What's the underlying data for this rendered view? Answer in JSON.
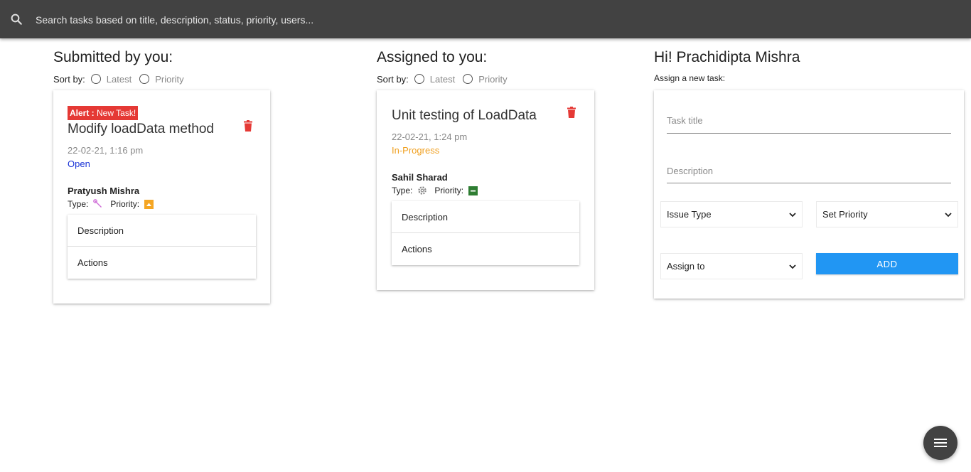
{
  "search": {
    "placeholder": "Search tasks based on title, description, status, priority, users..."
  },
  "submitted": {
    "heading": "Submitted by you:",
    "sort_label": "Sort by:",
    "sort_options": [
      "Latest",
      "Priority"
    ],
    "task": {
      "alert_prefix": "Alert : ",
      "alert_text": "New Task!",
      "title": "Modify loadData method",
      "date": "22-02-21, 1:16 pm",
      "status": "Open",
      "status_color": "#1a33d6",
      "user": "Pratyush Mishra",
      "type_label": "Type:",
      "priority_label": "Priority:",
      "type_icon": "wrench-icon",
      "priority_icon": "priority-high-icon",
      "accordion": [
        "Description",
        "Actions"
      ]
    }
  },
  "assigned": {
    "heading": "Assigned to you:",
    "sort_label": "Sort by:",
    "sort_options": [
      "Latest",
      "Priority"
    ],
    "task": {
      "title": "Unit testing of LoadData",
      "date": "22-02-21, 1:24 pm",
      "status": "In-Progress",
      "status_color": "#f0a020",
      "user": "Sahil Sharad",
      "type_label": "Type:",
      "priority_label": "Priority:",
      "type_icon": "gear-icon",
      "priority_icon": "priority-medium-icon",
      "accordion": [
        "Description",
        "Actions"
      ]
    }
  },
  "new_task": {
    "greeting": "Hi! Prachidipta Mishra",
    "subtitle": "Assign a new task:",
    "title_placeholder": "Task title",
    "description_placeholder": "Description",
    "issue_type": "Issue Type",
    "priority": "Set Priority",
    "assign_to": "Assign to",
    "add_label": "ADD"
  },
  "colors": {
    "topbar": "#424242",
    "accent": "#2196f3",
    "alert": "#e53935",
    "trash": "#e53935",
    "priority_high": "#f5a623",
    "priority_medium": "#2e7d32"
  }
}
